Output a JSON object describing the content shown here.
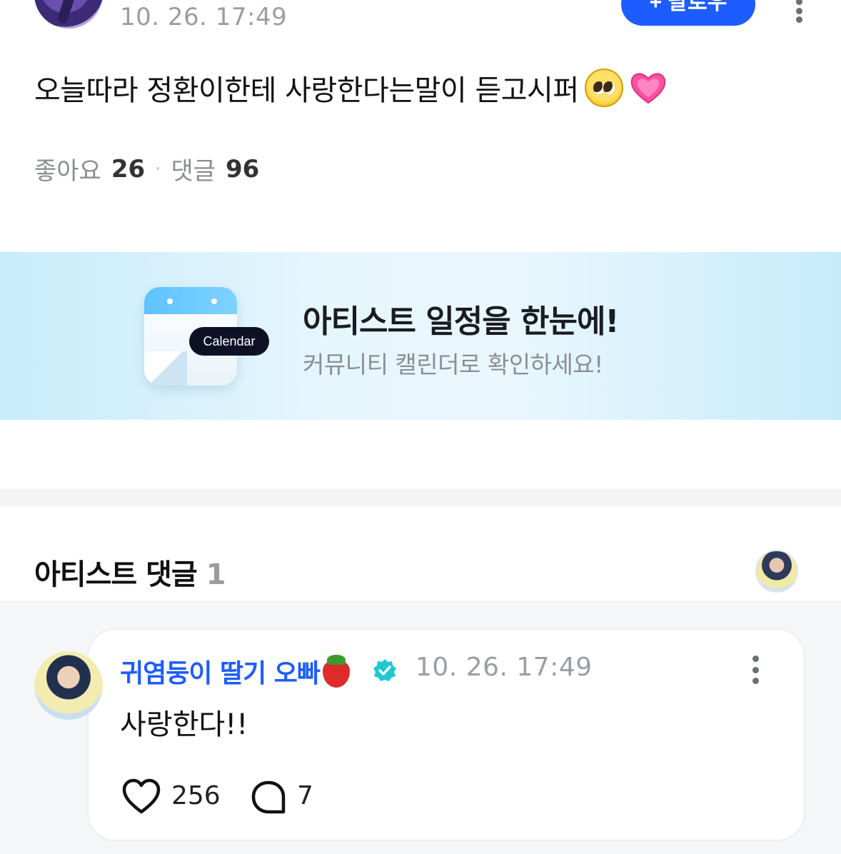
{
  "post": {
    "time": "10. 26. 17:49",
    "follow_label": "+ 팔로우",
    "body": "오늘따라 정환이한테 사랑한다는말이 듣고시퍼",
    "emojis": [
      "pleading-face-emoji",
      "growing-heart-emoji"
    ],
    "likes_label": "좋아요",
    "likes_count": "26",
    "comments_label": "댓글",
    "comments_count": "96"
  },
  "banner": {
    "pill": "Calendar",
    "title": "아티스트 일정을 한눈에!",
    "subtitle": "커뮤니티 캘린더로 확인하세요!"
  },
  "artist_comments": {
    "title": "아티스트 댓글",
    "count": "1"
  },
  "comment": {
    "author": "귀염둥이 딸기 오빠",
    "time": "10. 26. 17:49",
    "text": "사랑한다!!",
    "likes": "256",
    "replies": "7"
  },
  "colors": {
    "accent": "#1d5cff",
    "verified": "#1ec8d4",
    "muted_text": "#9a9da3"
  }
}
